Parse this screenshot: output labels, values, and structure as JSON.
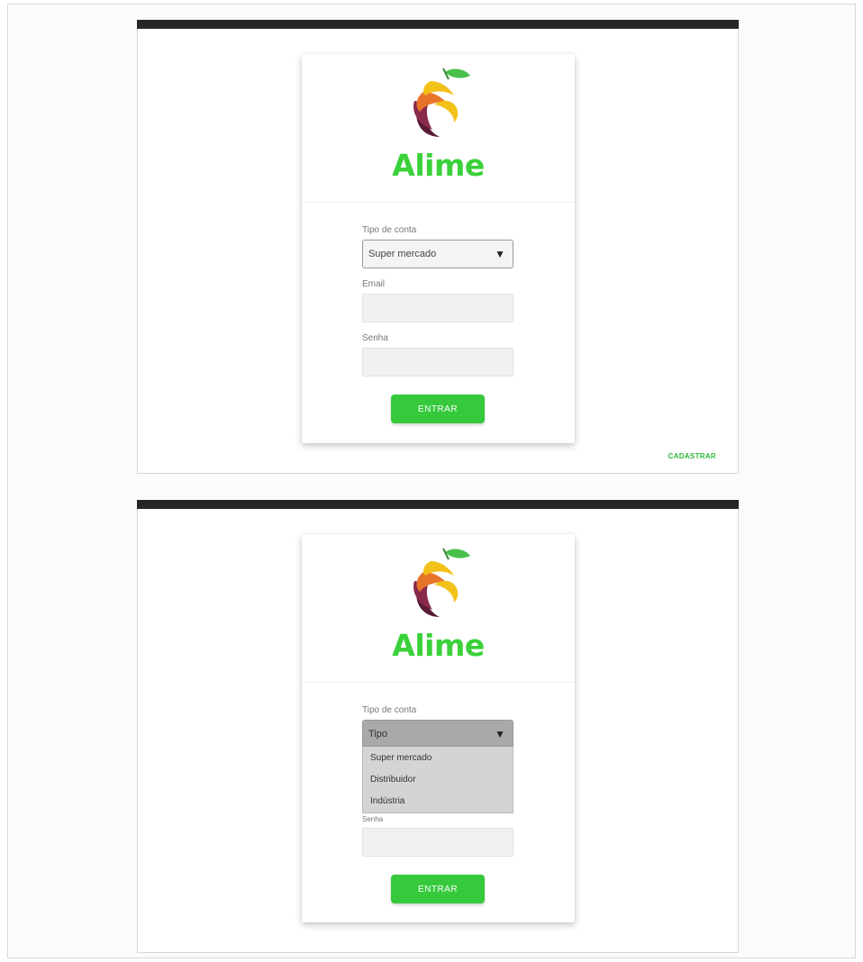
{
  "brand": {
    "name": "Alime",
    "color": "#3ad13a",
    "logo_colors": [
      "#5a1a3a",
      "#e8742a",
      "#f2c21a",
      "#49c04a"
    ]
  },
  "login_closed": {
    "account_type_label": "Tipo de conta",
    "account_type_value": "Super mercado",
    "email_label": "Email",
    "email_value": "",
    "password_label": "Senha",
    "password_value": "",
    "submit_label": "ENTRAR",
    "register_link": "CADASTRAR"
  },
  "login_open": {
    "account_type_label": "Tipo de conta",
    "account_type_value": "Tipo",
    "options": [
      "Super mercado",
      "Distribuidor",
      "Indústria"
    ],
    "password_label": "Senha",
    "password_value": "",
    "submit_label": "ENTRAR"
  },
  "icons": {
    "caret": "dropdown-caret-icon"
  }
}
